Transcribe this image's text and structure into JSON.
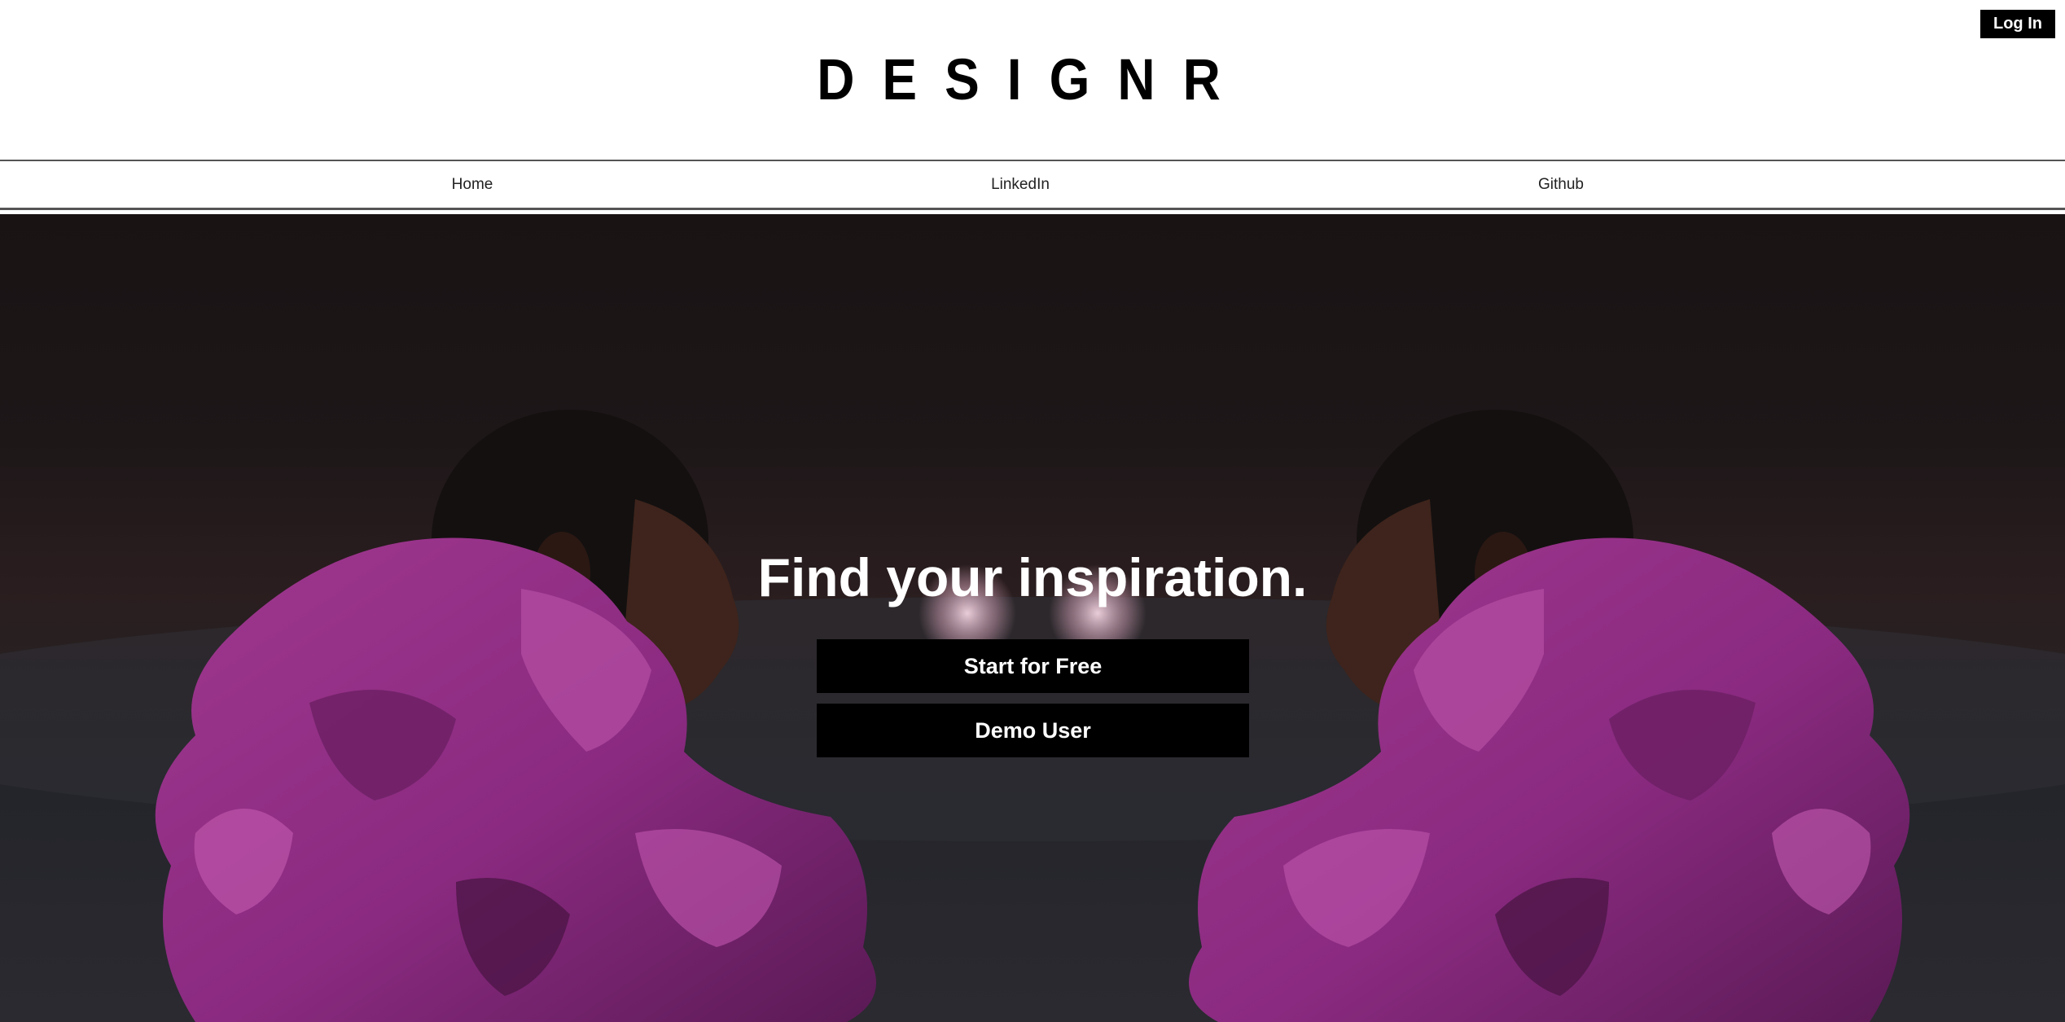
{
  "brand": {
    "logo_text": "DESIGNR"
  },
  "header": {
    "login_label": "Log In"
  },
  "nav": {
    "items": [
      {
        "label": "Home"
      },
      {
        "label": "LinkedIn"
      },
      {
        "label": "Github"
      }
    ]
  },
  "hero": {
    "title": "Find your inspiration.",
    "primary_cta": "Start for Free",
    "secondary_cta": "Demo User",
    "image_description_colors": {
      "background": "#1c1617",
      "garment_purple": "#8e2d83",
      "skin": "#4a2c22"
    }
  }
}
